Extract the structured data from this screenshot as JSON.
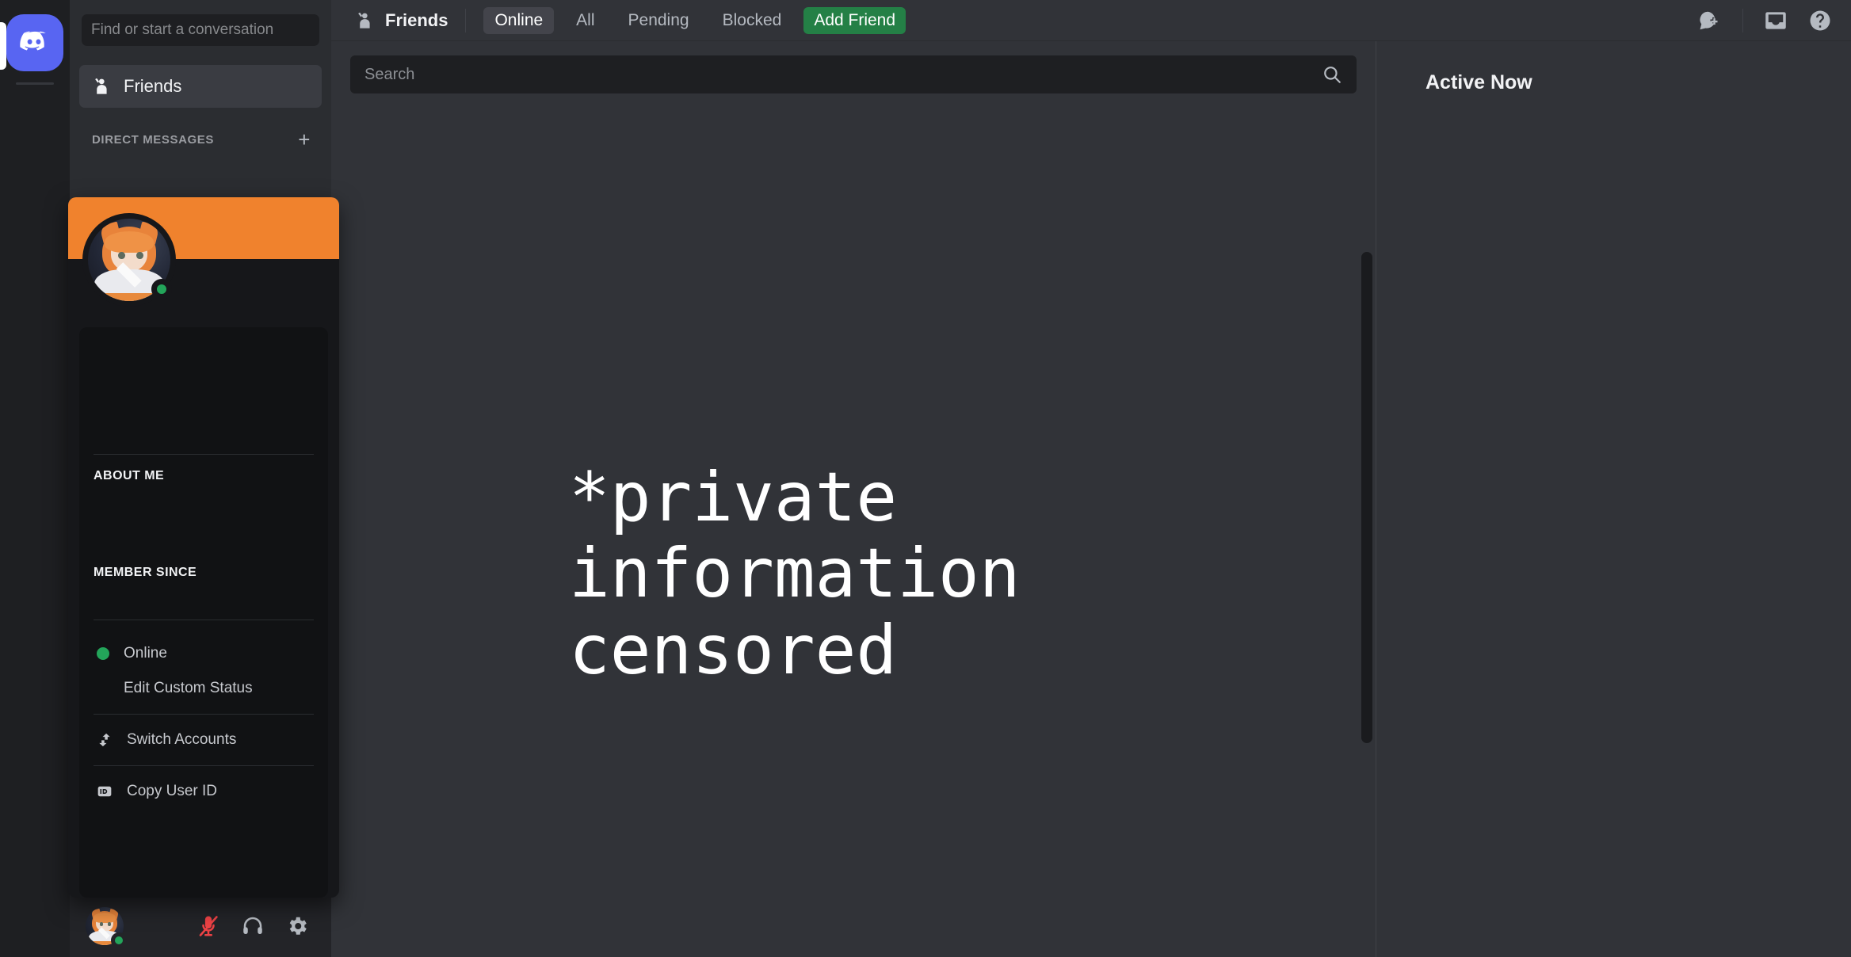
{
  "app": {
    "name": "Discord"
  },
  "rail": {
    "server_icon": "discord-logo-icon",
    "home_tooltip": "Direct Messages"
  },
  "sidebar": {
    "search_placeholder": "Find or start a conversation",
    "friends_label": "Friends",
    "friends_icon": "friends-wave-icon",
    "dm_category_label": "DIRECT MESSAGES",
    "dm_add_icon": "plus-icon"
  },
  "userbar": {
    "avatar_icon": "user-avatar",
    "status": "online",
    "mic_icon": "microphone-muted-icon",
    "headset_icon": "headset-icon",
    "settings_icon": "gear-icon"
  },
  "profile_popout": {
    "banner_color": "#f0822d",
    "status": "online",
    "about_me_label": "ABOUT ME",
    "member_since_label": "MEMBER SINCE",
    "menu": [
      {
        "label": "Online",
        "icon": "status-online-dot",
        "indent": false
      },
      {
        "label": "Edit Custom Status",
        "icon": "",
        "indent": true
      },
      {
        "label": "Switch Accounts",
        "icon": "switch-accounts-icon",
        "indent": false
      },
      {
        "label": "Copy User ID",
        "icon": "id-badge-icon",
        "indent": false
      }
    ]
  },
  "topbar": {
    "title": "Friends",
    "title_icon": "friends-wave-icon",
    "tabs": [
      {
        "label": "Online",
        "active": true
      },
      {
        "label": "All",
        "active": false
      },
      {
        "label": "Pending",
        "active": false
      },
      {
        "label": "Blocked",
        "active": false
      }
    ],
    "add_friend_label": "Add Friend",
    "add_friend_color": "#248046",
    "icons": [
      {
        "name": "new-group-dm-icon"
      },
      {
        "name": "inbox-icon"
      },
      {
        "name": "help-icon"
      }
    ]
  },
  "main": {
    "search_placeholder": "Search",
    "search_icon": "search-icon",
    "censored_text": "*private\ninformation\ncensored"
  },
  "active_now": {
    "title": "Active Now"
  }
}
